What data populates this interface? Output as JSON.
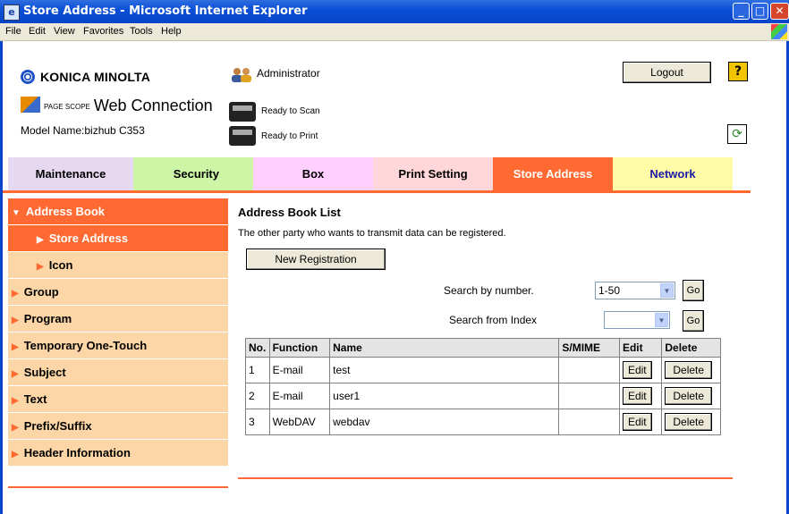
{
  "window": {
    "title": "Store Address - Microsoft Internet Explorer"
  },
  "menu": [
    "File",
    "Edit",
    "View",
    "Favorites",
    "Tools",
    "Help"
  ],
  "header": {
    "brand": "KONICA MINOLTA",
    "product": "Web Connection",
    "product_prefix": "PAGE SCOPE",
    "model": "Model Name:bizhub C353",
    "user": "Administrator",
    "scan_status": "Ready to Scan",
    "print_status": "Ready to Print",
    "logout_label": "Logout",
    "help_label": "?"
  },
  "tabs": [
    {
      "label": "Maintenance",
      "color": "#e6d8f0"
    },
    {
      "label": "Security",
      "color": "#ccf5a6"
    },
    {
      "label": "Box",
      "color": "#ffd0ff"
    },
    {
      "label": "Print Setting",
      "color": "#ffd6da"
    },
    {
      "label": "Store Address",
      "color": "#ff6a33",
      "active": true
    },
    {
      "label": "Network",
      "color": "#fffba6"
    }
  ],
  "sidebar": [
    {
      "label": "Address Book"
    },
    {
      "label": "Store Address"
    },
    {
      "label": "Icon"
    },
    {
      "label": "Group"
    },
    {
      "label": "Program"
    },
    {
      "label": "Temporary One-Touch"
    },
    {
      "label": "Subject"
    },
    {
      "label": "Text"
    },
    {
      "label": "Prefix/Suffix"
    },
    {
      "label": "Header Information"
    }
  ],
  "main": {
    "heading": "Address Book List",
    "description": "The other party who wants to transmit data can be registered.",
    "new_registration": "New Registration",
    "search_number_label": "Search by number.",
    "search_number_value": "1-50",
    "search_index_label": "Search from Index",
    "search_index_value": "",
    "go_label": "Go",
    "columns": [
      "No.",
      "Function",
      "Name",
      "S/MIME",
      "Edit",
      "Delete"
    ],
    "rows": [
      {
        "no": "1",
        "function": "E-mail",
        "name": "test",
        "smime": "",
        "edit": "Edit",
        "delete": "Delete"
      },
      {
        "no": "2",
        "function": "E-mail",
        "name": "user1",
        "smime": "",
        "edit": "Edit",
        "delete": "Delete"
      },
      {
        "no": "3",
        "function": "WebDAV",
        "name": "webdav",
        "smime": "",
        "edit": "Edit",
        "delete": "Delete"
      }
    ]
  },
  "colors": {
    "accent": "#ff6a33",
    "sidebar_bg": "#fcd6a6",
    "titlebar": "#0a4fd6"
  }
}
